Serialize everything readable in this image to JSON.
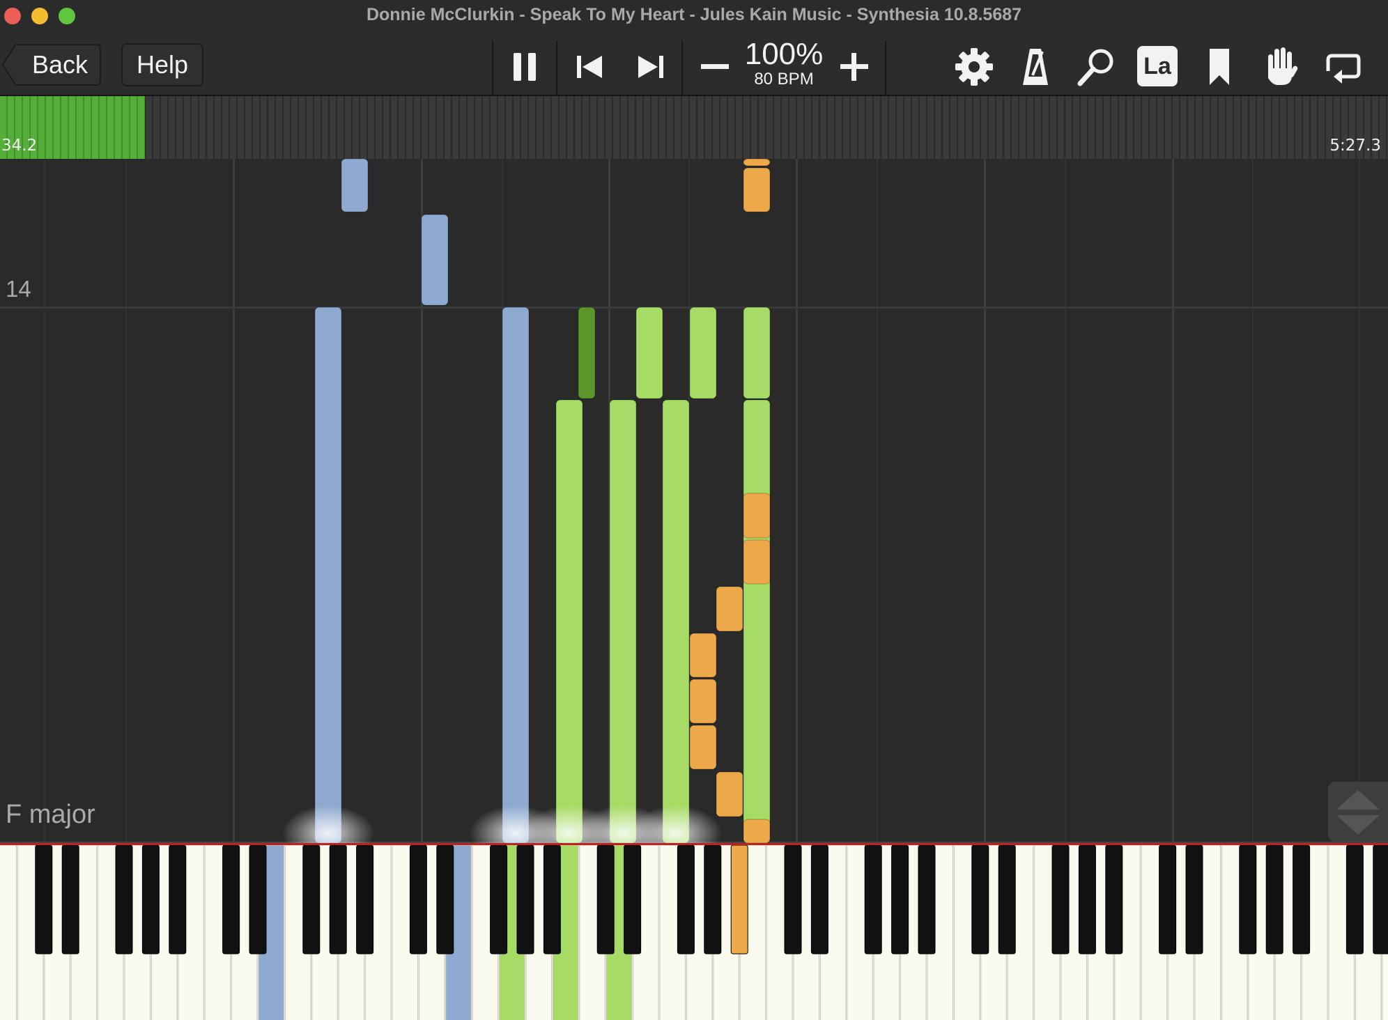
{
  "window": {
    "title": "Donnie McClurkin - Speak To My Heart - Jules Kain Music - Synthesia 10.8.5687",
    "traffic_light_colors": [
      "#ec5f57",
      "#f4bd2f",
      "#5fc73e"
    ]
  },
  "toolbar": {
    "back_label": "Back",
    "help_label": "Help",
    "speed": "100%",
    "bpm": "80 BPM",
    "icons": [
      "pause-icon",
      "skip-back-icon",
      "skip-forward-icon",
      "minus-icon",
      "plus-icon",
      "gear-icon",
      "metronome-icon",
      "magnifier-icon",
      "note-labels-icon",
      "bookmark-icon",
      "hand-icon",
      "loop-icon"
    ],
    "note_labels_text": "La"
  },
  "progress": {
    "current_time": "34.2",
    "total_time": "5:27.3",
    "fraction": 0.1045
  },
  "notes_area": {
    "measure_number": "14",
    "key_signature": "F major"
  },
  "colors": {
    "left_hand": "#8eaad0",
    "right_hand": "#a6dc66",
    "right_hand_dark": "#5c962a",
    "third_track": "#eda84a",
    "progress_fill": "#4fa838",
    "background": "#2a2a2a"
  }
}
